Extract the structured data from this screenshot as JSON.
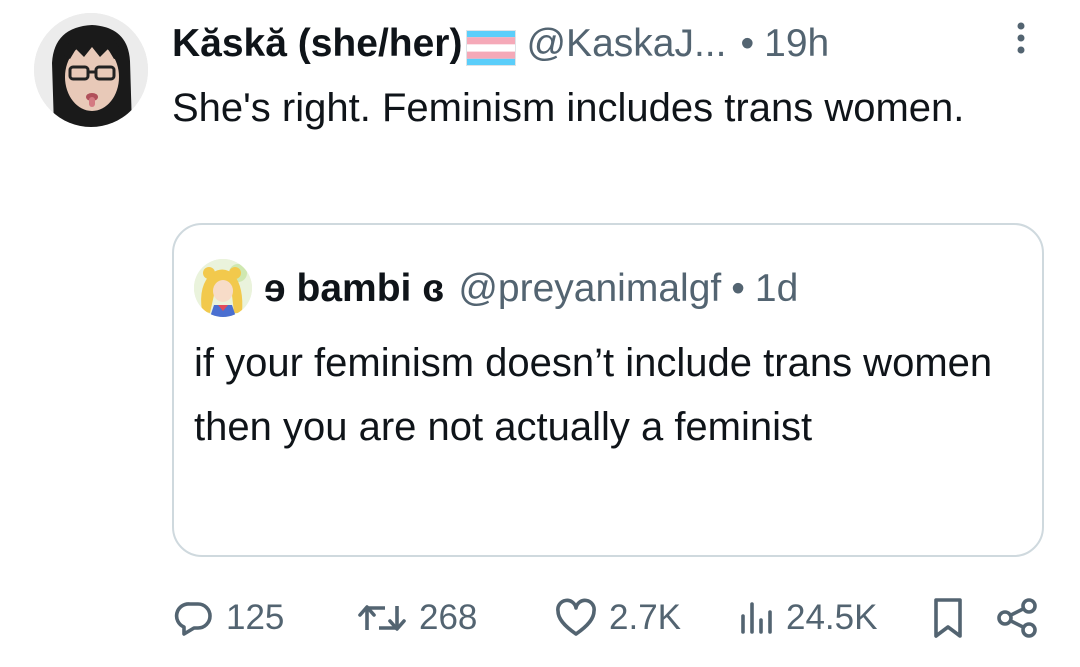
{
  "tweet": {
    "display_name": "Kăskă (she/her)",
    "flag_icon": "transgender-flag-icon",
    "handle": "@KaskaJ...",
    "separator": "•",
    "time": "19h",
    "text": "She's right. Feminism includes trans women."
  },
  "quote": {
    "display_name": "ɘ bambi ɞ",
    "handle": "@preyanimalgf",
    "separator": "•",
    "time": "1d",
    "text": "if your feminism doesn’t include trans women then you are not actually a feminist"
  },
  "actions": {
    "replies": "125",
    "retweets": "268",
    "likes": "2.7K",
    "views": "24.5K"
  },
  "colors": {
    "text": "#0f1419",
    "secondary": "#536471",
    "border": "#cfd9de",
    "flag_blue": "#5bcefa",
    "flag_pink": "#f5a9b8",
    "flag_white": "#ffffff"
  }
}
